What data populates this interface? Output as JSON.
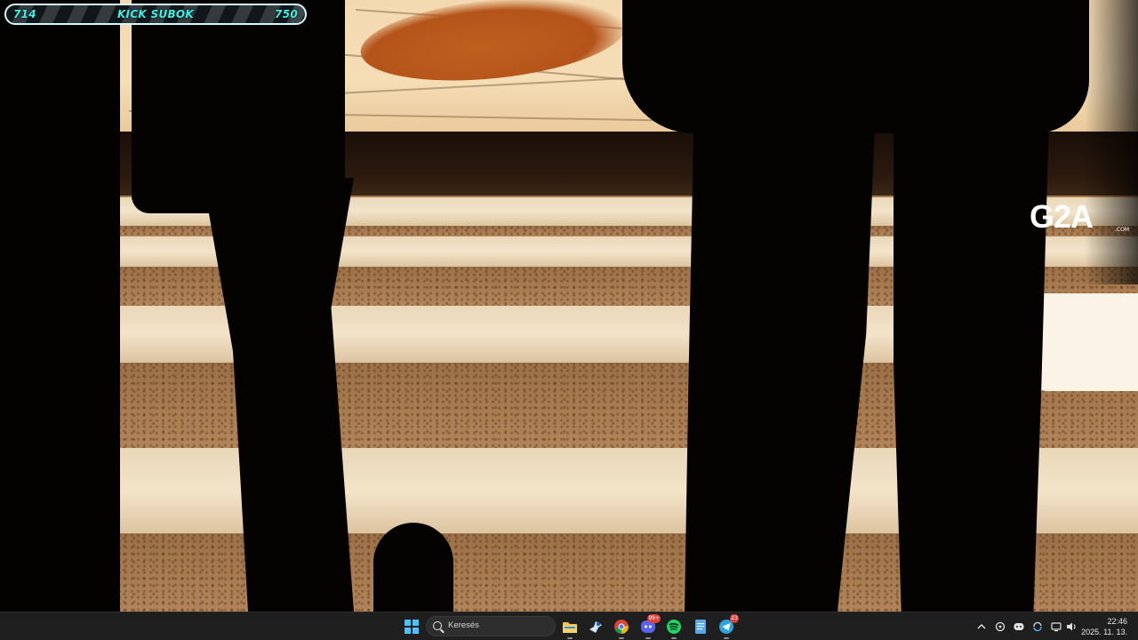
{
  "stream_overlay": {
    "subgoal": {
      "current": "714",
      "label": "KICK SUBOK",
      "target": "750",
      "progress_fraction": 0.952
    },
    "sponsor_logo": {
      "text": "G2A",
      "suffix": ".COM"
    }
  },
  "taskbar": {
    "search": {
      "placeholder": "Keresés"
    },
    "apps": [
      {
        "name": "File Explorer",
        "icon": "folder-icon",
        "running": true
      },
      {
        "name": "Steam",
        "icon": "steam-icon",
        "running": false
      },
      {
        "name": "Chrome",
        "icon": "chrome-icon",
        "running": true
      },
      {
        "name": "Discord",
        "icon": "discord-icon",
        "running": true,
        "badge": "99+"
      },
      {
        "name": "Spotify",
        "icon": "spotify-icon",
        "running": true
      },
      {
        "name": "Notepad",
        "icon": "notepad-icon",
        "running": false
      },
      {
        "name": "Telegram",
        "icon": "telegram-icon",
        "running": true,
        "badge": "23"
      }
    ],
    "clock": {
      "time": "22:46",
      "date": "2025. 11. 13."
    },
    "colors": {
      "taskbar_bg": "#1f1f1f",
      "accent": "#4cc2ff",
      "overlay_text": "#3ff0e6"
    }
  }
}
